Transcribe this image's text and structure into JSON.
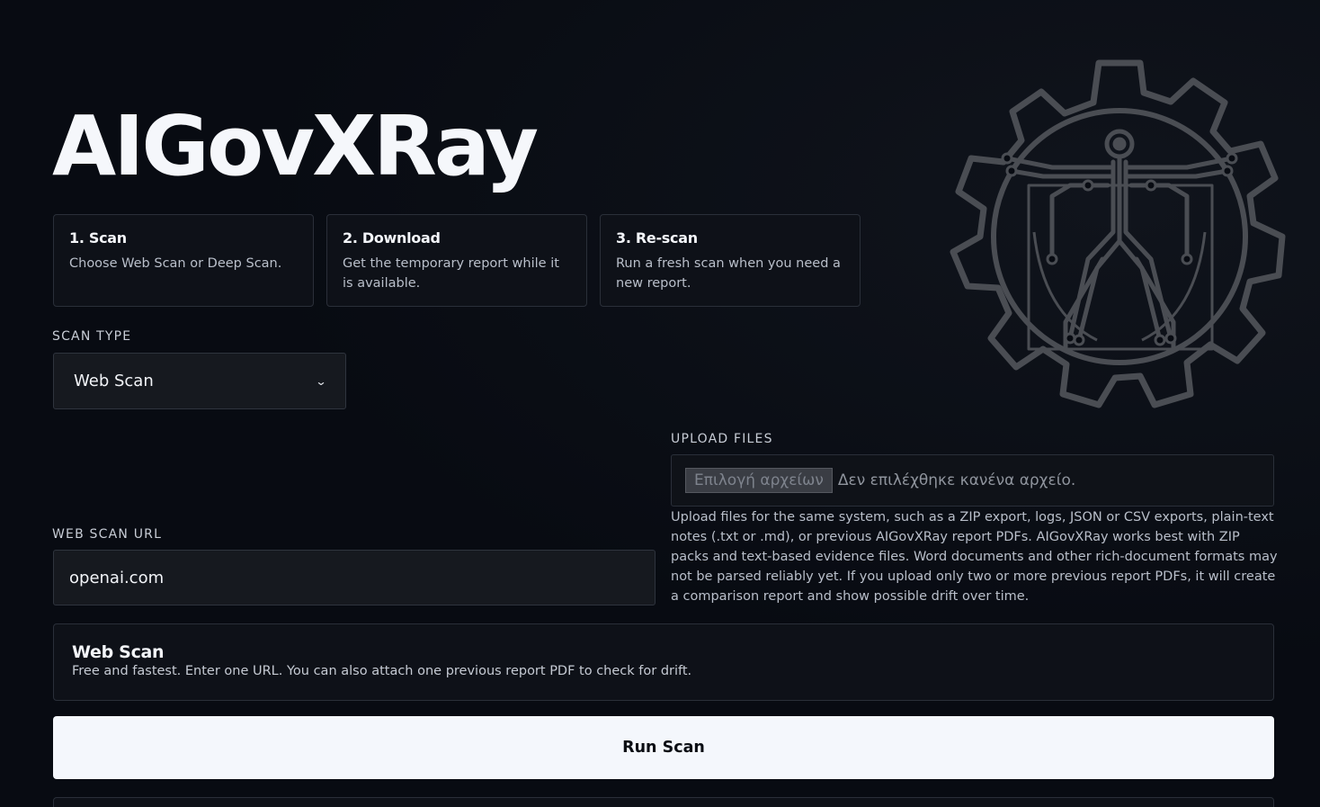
{
  "app": {
    "title": "AIGovXRay"
  },
  "steps": [
    {
      "title": "1. Scan",
      "description": "Choose Web Scan or Deep Scan."
    },
    {
      "title": "2. Download",
      "description": "Get the temporary report while it is available."
    },
    {
      "title": "3. Re-scan",
      "description": "Run a fresh scan when you need a new report."
    }
  ],
  "scan_type": {
    "label": "SCAN TYPE",
    "selected": "Web Scan"
  },
  "web_scan_url": {
    "label": "WEB SCAN URL",
    "value": "openai.com"
  },
  "upload": {
    "label": "UPLOAD FILES",
    "button_label": "Επιλογή αρχείων",
    "status": "Δεν επιλέχθηκε κανένα αρχείο.",
    "help": "Upload files for the same system, such as a ZIP export, logs, JSON or CSV exports, plain-text notes (.txt or .md), or previous AIGovXRay report PDFs. AIGovXRay works best with ZIP packs and text-based evidence files. Word documents and other rich-document formats may not be parsed reliably yet. If you upload only two or more previous report PDFs, it will create a comparison report and show possible drift over time."
  },
  "mode_info": {
    "title": "Web Scan",
    "description": "Free and fastest. Enter one URL. You can also attach one previous report PDF to check for drift."
  },
  "actions": {
    "run_label": "Run Scan"
  },
  "icons": {
    "logo": "gear-vitruvian-circuit-logo",
    "select_arrow": "chevron-down-icon"
  },
  "colors": {
    "background": "#080b12",
    "panel": "#0e1118",
    "input": "#16191f",
    "border": "#2a2f39",
    "button": "#f4f7fc",
    "logo_stroke": "#4a4d53"
  }
}
